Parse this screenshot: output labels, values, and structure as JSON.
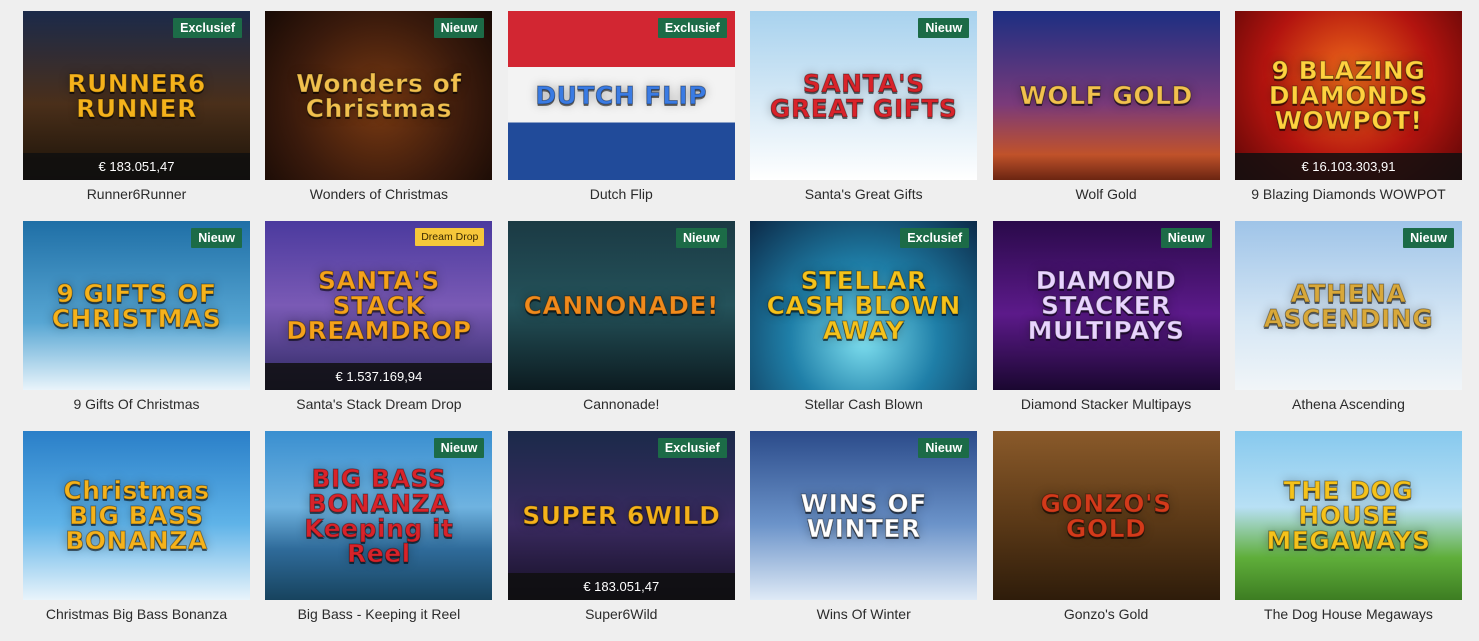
{
  "games": [
    {
      "title": "Runner6Runner",
      "logo": "RUNNER6 RUNNER",
      "badge": "Exclusief",
      "jackpot": "€ 183.051,47",
      "bg": "linear-gradient(180deg,#1b2a4a 0%,#4a2f1a 55%,#1a1208 100%)",
      "logoColor": "#f5b21b",
      "icon": "bell-icon"
    },
    {
      "title": "Wonders of Christmas",
      "logo": "Wonders of Christmas",
      "badge": "Nieuw",
      "jackpot": null,
      "bg": "radial-gradient(circle at 50% 55%,#7a3a12 0%,#3a1a0c 60%,#170a05 100%)",
      "logoColor": "#f2c14e",
      "icon": "wreath-icon"
    },
    {
      "title": "Dutch Flip",
      "logo": "DUTCH FLIP",
      "badge": "Exclusief",
      "jackpot": null,
      "bg": "linear-gradient(180deg,#d22632 0%,#d22632 33%,#f3f3f3 33%,#f3f3f3 66%,#214b9a 66%,#214b9a 100%)",
      "logoColor": "#3a7be3",
      "icon": "flag-icon"
    },
    {
      "title": "Santa's Great Gifts",
      "logo": "SANTA'S GREAT GIFTS",
      "badge": "Nieuw",
      "jackpot": null,
      "bg": "linear-gradient(180deg,#a8d2ee 0%,#dcecf7 60%,#ffffff 100%)",
      "logoColor": "#d8232a",
      "icon": "snowman-icon"
    },
    {
      "title": "Wolf Gold",
      "logo": "WOLF GOLD",
      "badge": null,
      "jackpot": null,
      "bg": "linear-gradient(180deg,#1c2f82 0%,#7a3a7a 55%,#c0522a 85%,#6b2512 100%)",
      "logoColor": "#f2c14e",
      "icon": "wolf-icon"
    },
    {
      "title": "9 Blazing Diamonds WOWPOT",
      "logo": "9 BLAZING DIAMONDS WOWPOT!",
      "badge": null,
      "jackpot": "€ 16.103.303,91",
      "bg": "radial-gradient(circle at 50% 40%,#f16d1a 0%,#b3140f 55%,#5a0606 100%)",
      "logoColor": "#ffd23f",
      "icon": "diamond-icon"
    },
    {
      "title": "9 Gifts Of Christmas",
      "logo": "9 GIFTS OF CHRISTMAS",
      "badge": "Nieuw",
      "jackpot": null,
      "bg": "linear-gradient(180deg,#1f6fa6 0%,#57a6d3 60%,#e9f4fb 100%)",
      "logoColor": "#f5b21b",
      "icon": "santa-icon"
    },
    {
      "title": "Santa's Stack Dream Drop",
      "logo": "SANTA'S STACK DREAMDROP",
      "badge": "Dream Drop",
      "jackpot": "€ 1.537.169,94",
      "bg": "linear-gradient(180deg,#4b3a9e 0%,#7a5ab5 50%,#2c2760 100%)",
      "logoColor": "#f5a21b",
      "icon": "tree-icon"
    },
    {
      "title": "Cannonade!",
      "logo": "CANNONADE!",
      "badge": "Nieuw",
      "jackpot": null,
      "bg": "linear-gradient(180deg,#1b3a44 0%,#24525a 50%,#0c1b20 100%)",
      "logoColor": "#f08a1c",
      "icon": "ship-icon"
    },
    {
      "title": "Stellar Cash Blown",
      "logo": "STELLAR CASH BLOWN AWAY",
      "badge": "Exclusief",
      "jackpot": null,
      "bg": "radial-gradient(circle at 50% 70%,#7fe0f0 0%,#1f7fa8 45%,#0c2a48 100%)",
      "logoColor": "#f5c21b",
      "icon": "tornado-icon"
    },
    {
      "title": "Diamond Stacker Multipays",
      "logo": "DIAMOND STACKER MULTIPAYS",
      "badge": "Nieuw",
      "jackpot": null,
      "bg": "linear-gradient(180deg,#2a0a4a 0%,#5c1a8a 55%,#1a0730 100%)",
      "logoColor": "#e9d4ff",
      "icon": "gem-icon"
    },
    {
      "title": "Athena Ascending",
      "logo": "ATHENA ASCENDING",
      "badge": "Nieuw",
      "jackpot": null,
      "bg": "linear-gradient(180deg,#9fc4e8 0%,#d6e7f5 60%,#f1f5f8 100%)",
      "logoColor": "#d8a83a",
      "icon": "athena-icon"
    },
    {
      "title": "Christmas Big Bass Bonanza",
      "logo": "Christmas BIG BASS BONANZA",
      "badge": null,
      "jackpot": null,
      "bg": "linear-gradient(180deg,#2a7fc8 0%,#5fb3e8 55%,#e9f4fb 100%)",
      "logoColor": "#f5b21b",
      "icon": "fish-icon"
    },
    {
      "title": "Big Bass - Keeping it Reel",
      "logo": "BIG BASS BONANZA Keeping it Reel",
      "badge": "Nieuw",
      "jackpot": null,
      "bg": "linear-gradient(180deg,#3a8fd0 0%,#6fb3e0 45%,#2f6b9a 70%,#17435e 100%)",
      "logoColor": "#d8232a",
      "icon": "fish-icon"
    },
    {
      "title": "Super6Wild",
      "logo": "SUPER 6WILD",
      "badge": "Exclusief",
      "jackpot": "€ 183.051,47",
      "bg": "linear-gradient(180deg,#1b2a4a 0%,#3a2a60 55%,#150f24 100%)",
      "logoColor": "#f5b21b",
      "icon": "bell-icon"
    },
    {
      "title": "Wins Of Winter",
      "logo": "WINS OF WINTER",
      "badge": "Nieuw",
      "jackpot": null,
      "bg": "linear-gradient(180deg,#2b4b8a 0%,#6b93c9 55%,#dfeaf6 100%)",
      "logoColor": "#ffffff",
      "icon": "snowflake-icon"
    },
    {
      "title": "Gonzo's Gold",
      "logo": "GONZO'S GOLD",
      "badge": null,
      "jackpot": null,
      "bg": "linear-gradient(180deg,#8a5a2a 0%,#5e3b18 50%,#2e1c0a 100%)",
      "logoColor": "#d33a1a",
      "icon": "conquistador-icon"
    },
    {
      "title": "The Dog House Megaways",
      "logo": "THE DOG HOUSE MEGAWAYS",
      "badge": null,
      "jackpot": null,
      "bg": "linear-gradient(180deg,#87c9ee 0%,#b8e0f5 45%,#5fae3a 75%,#3d7d22 100%)",
      "logoColor": "#f5c21b",
      "icon": "dog-icon"
    }
  ]
}
